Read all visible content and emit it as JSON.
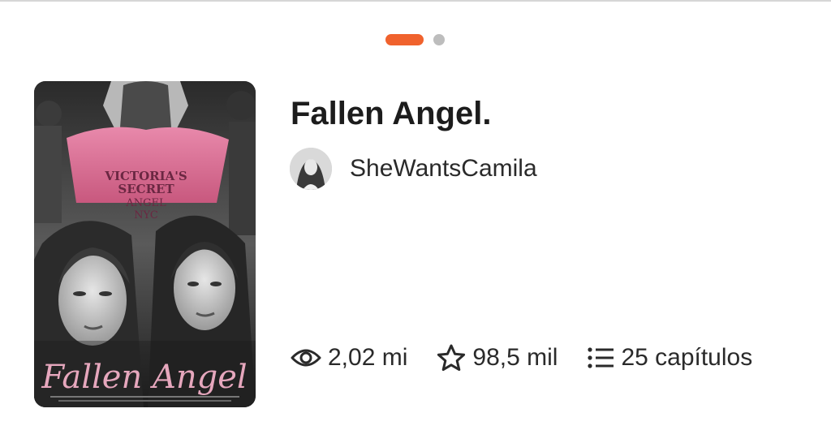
{
  "colors": {
    "accent": "#f0622d",
    "dot_inactive": "#bdbdbd",
    "text_dark": "#1c1c1c"
  },
  "pager": {
    "active_index": 0,
    "total": 2
  },
  "story": {
    "title": "Fallen Angel.",
    "author": "SheWantsCamila",
    "cover": {
      "title_text": "Fallen Angel",
      "shirt_text_line1": "VICTORIA'S",
      "shirt_text_line2": "SECRET",
      "shirt_text_line3": "ANGEL",
      "shirt_text_line4": "NYC"
    }
  },
  "stats": {
    "reads": {
      "icon": "eye-icon",
      "value": "2,02 mi"
    },
    "votes": {
      "icon": "star-icon",
      "value": "98,5 mil"
    },
    "parts": {
      "icon": "list-icon",
      "value": "25 capítulos"
    }
  }
}
